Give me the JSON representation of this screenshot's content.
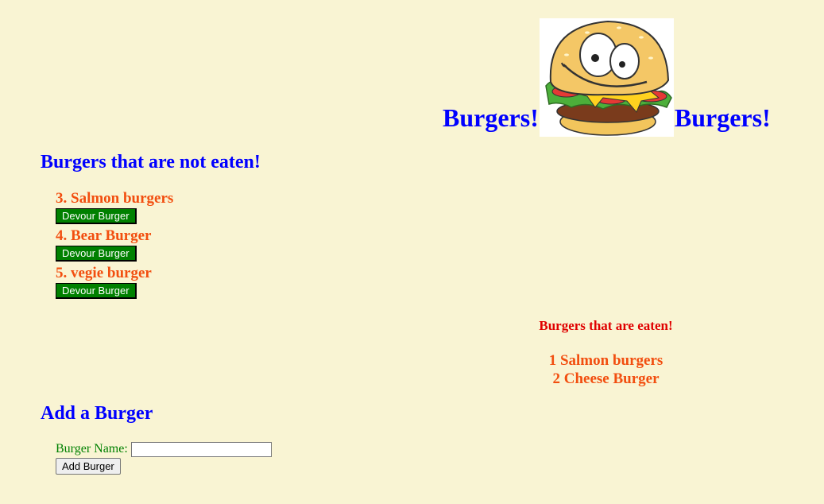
{
  "header": {
    "title_left": "Burgers!",
    "title_right": "Burgers!",
    "logo_icon": "smiling-burger-icon"
  },
  "uneaten": {
    "heading": "Burgers that are not eaten!",
    "items": [
      {
        "name": "3. Salmon burgers",
        "button_label": "Devour Burger"
      },
      {
        "name": "4. Bear Burger",
        "button_label": "Devour Burger"
      },
      {
        "name": "5. vegie burger",
        "button_label": "Devour Burger"
      }
    ]
  },
  "eaten": {
    "heading": "Burgers that are eaten!",
    "items": [
      "1 Salmon burgers",
      "2 Cheese Burger"
    ]
  },
  "add": {
    "heading": "Add a Burger",
    "field_label": "Burger Name:",
    "input_value": "",
    "button_label": "Add Burger"
  },
  "colors": {
    "background": "#f9f4d3",
    "heading": "#0000ff",
    "burger_name": "#f24e0f",
    "eaten_heading": "#e00000",
    "devour_button": "#008000",
    "form_label": "#008000"
  }
}
